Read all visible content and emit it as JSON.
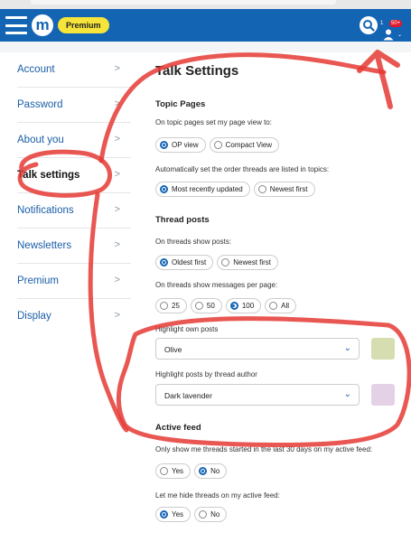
{
  "header": {
    "logo_letter": "m",
    "premium_label": "Premium",
    "notification_count": "1",
    "user_badge": "50+"
  },
  "sidebar": {
    "items": [
      {
        "label": "Account"
      },
      {
        "label": "Password"
      },
      {
        "label": "About you"
      },
      {
        "label": "Talk settings"
      },
      {
        "label": "Notifications"
      },
      {
        "label": "Newsletters"
      },
      {
        "label": "Premium"
      },
      {
        "label": "Display"
      }
    ],
    "active": "Talk settings"
  },
  "main": {
    "title": "Talk Settings",
    "topic_pages": {
      "heading": "Topic Pages",
      "view_desc": "On topic pages set my page view to:",
      "view_options": [
        "OP view",
        "Compact View"
      ],
      "view_selected": "OP view",
      "order_desc": "Automatically set the order threads are listed in topics:",
      "order_options": [
        "Most recently updated",
        "Newest first"
      ],
      "order_selected": "Most recently updated"
    },
    "thread_posts": {
      "heading": "Thread posts",
      "show_desc": "On threads show posts:",
      "show_options": [
        "Oldest first",
        "Newest first"
      ],
      "show_selected": "Oldest first",
      "per_page_desc": "On threads show messages per page:",
      "per_page_options": [
        "25",
        "50",
        "100",
        "All"
      ],
      "per_page_selected": "100",
      "own_desc": "Highlight own posts",
      "own_value": "Olive",
      "own_color": "#d6ddb0",
      "author_desc": "Highlight posts by thread author",
      "author_value": "Dark lavender",
      "author_color": "#e4d1e6"
    },
    "active_feed": {
      "heading": "Active feed",
      "recent_desc": "Only show me threads started in the last 30 days on my active feed:",
      "recent_options": [
        "Yes",
        "No"
      ],
      "recent_selected": "No",
      "hide_desc": "Let me hide threads on my active feed:",
      "hide_options": [
        "Yes",
        "No"
      ],
      "hide_selected": "Yes"
    }
  },
  "colors": {
    "brand_blue": "#1464b4",
    "premium_yellow": "#f6e43a",
    "annotation_red": "#e53935"
  }
}
